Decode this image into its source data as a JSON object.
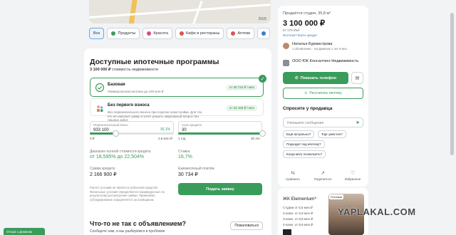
{
  "map": {
    "label": "2GIS"
  },
  "categories": [
    {
      "label": "Все",
      "active": true,
      "color": ""
    },
    {
      "label": "Продукты",
      "active": false,
      "color": "#3a9c5b"
    },
    {
      "label": "Красота",
      "active": false,
      "color": "#d94b8a"
    },
    {
      "label": "Кафе и рестораны",
      "active": false,
      "color": "#d9534f"
    },
    {
      "label": "Аптеки",
      "active": false,
      "color": "#d9534f"
    }
  ],
  "mortgage": {
    "title": "Доступные ипотечные программы",
    "price_value": "3 100 000 ₽",
    "price_caption": "стоимость недвижимости",
    "programs": [
      {
        "name": "Базовая",
        "desc": "Универсальная ипотека до 100 млн ₽",
        "badge": "от 30 734 ₽ / мес"
      },
      {
        "name": "Без первого взноса",
        "desc": "Без первоначального взноса при покупке новостройки. Для тех, кто не накопил сумму и хочет решить квартирный вопрос без лишних забот.",
        "badge": "от 33 183 ₽ / мес"
      }
    ],
    "down_payment": {
      "label": "Первоначальный взнос",
      "value": "933 100",
      "percent": "30,1%",
      "min": "0 ₽",
      "max": "2,8 млн ₽",
      "fraction": 0.301
    },
    "term": {
      "label": "Срок кредита",
      "value": "30",
      "min": "1 год",
      "max": "30 лет",
      "fraction": 1.0
    },
    "rate_range": {
      "label": "Диапазон полной стоимости кредита",
      "value": "от 18,595% до 22,504%"
    },
    "rate": {
      "label": "Ставка",
      "value": "16,7%"
    },
    "credit_sum": {
      "label": "Сумма кредита",
      "value": "2 166 900 ₽"
    },
    "monthly": {
      "label": "Ежемесячный платёж",
      "value": "30 734 ₽"
    },
    "note": "Расчёт условий не является публичной офертой. Финальные условия определяются индивидуально по результатам рассмотрения заявки. Применимо субсидирование определяется застройщиком.",
    "apply_button": "Подать заявку"
  },
  "issue": {
    "title": "Что-то не так с объявлением?",
    "subtitle": "Сообщите нам, и мы разберёмся в проблеме",
    "button": "Пожаловаться"
  },
  "listing": {
    "title": "Продаётся студия, 35,8 м²",
    "price": "3 100 000 ₽",
    "price_per_m": "87 078 ₽/м²",
    "mortgage_link": "Ипотека? Взять кредит",
    "seller_name": "Наталья Бурмистрова",
    "seller_info": "1 объявление · На Домклик 1 лет 9 мес.",
    "company": "ООО ЮК Консалтинг-Недвижимость",
    "phone_button": "Показать телефон",
    "mortgage_button": "Рассчитать ипотеку",
    "ask_title": "Спросите у продавца",
    "message_placeholder": "Напишите сообщение",
    "questions": [
      "Ещё актуально?",
      "Торг уместен?",
      "Подходит под ипотеку?",
      "Когда могу посмотреть?"
    ]
  },
  "actions": [
    {
      "label": "Сравнить",
      "icon": "compare-icon"
    },
    {
      "label": "Поделиться",
      "icon": "share-icon"
    },
    {
      "label": "Избранное",
      "icon": "heart-icon"
    }
  ],
  "complex": {
    "title": "ЖК Elementum*",
    "rows": [
      "Студии от 5,5 млн ₽",
      "2-комн. от 6,9 млн ₽",
      "3-комн. от 8,8 млн ₽",
      "4-комн. от 8,8 млн ₽"
    ],
    "tag": "Реклама"
  },
  "back_button": "Отзыв о Домклик",
  "watermark": "YAPLAKAL.COM"
}
